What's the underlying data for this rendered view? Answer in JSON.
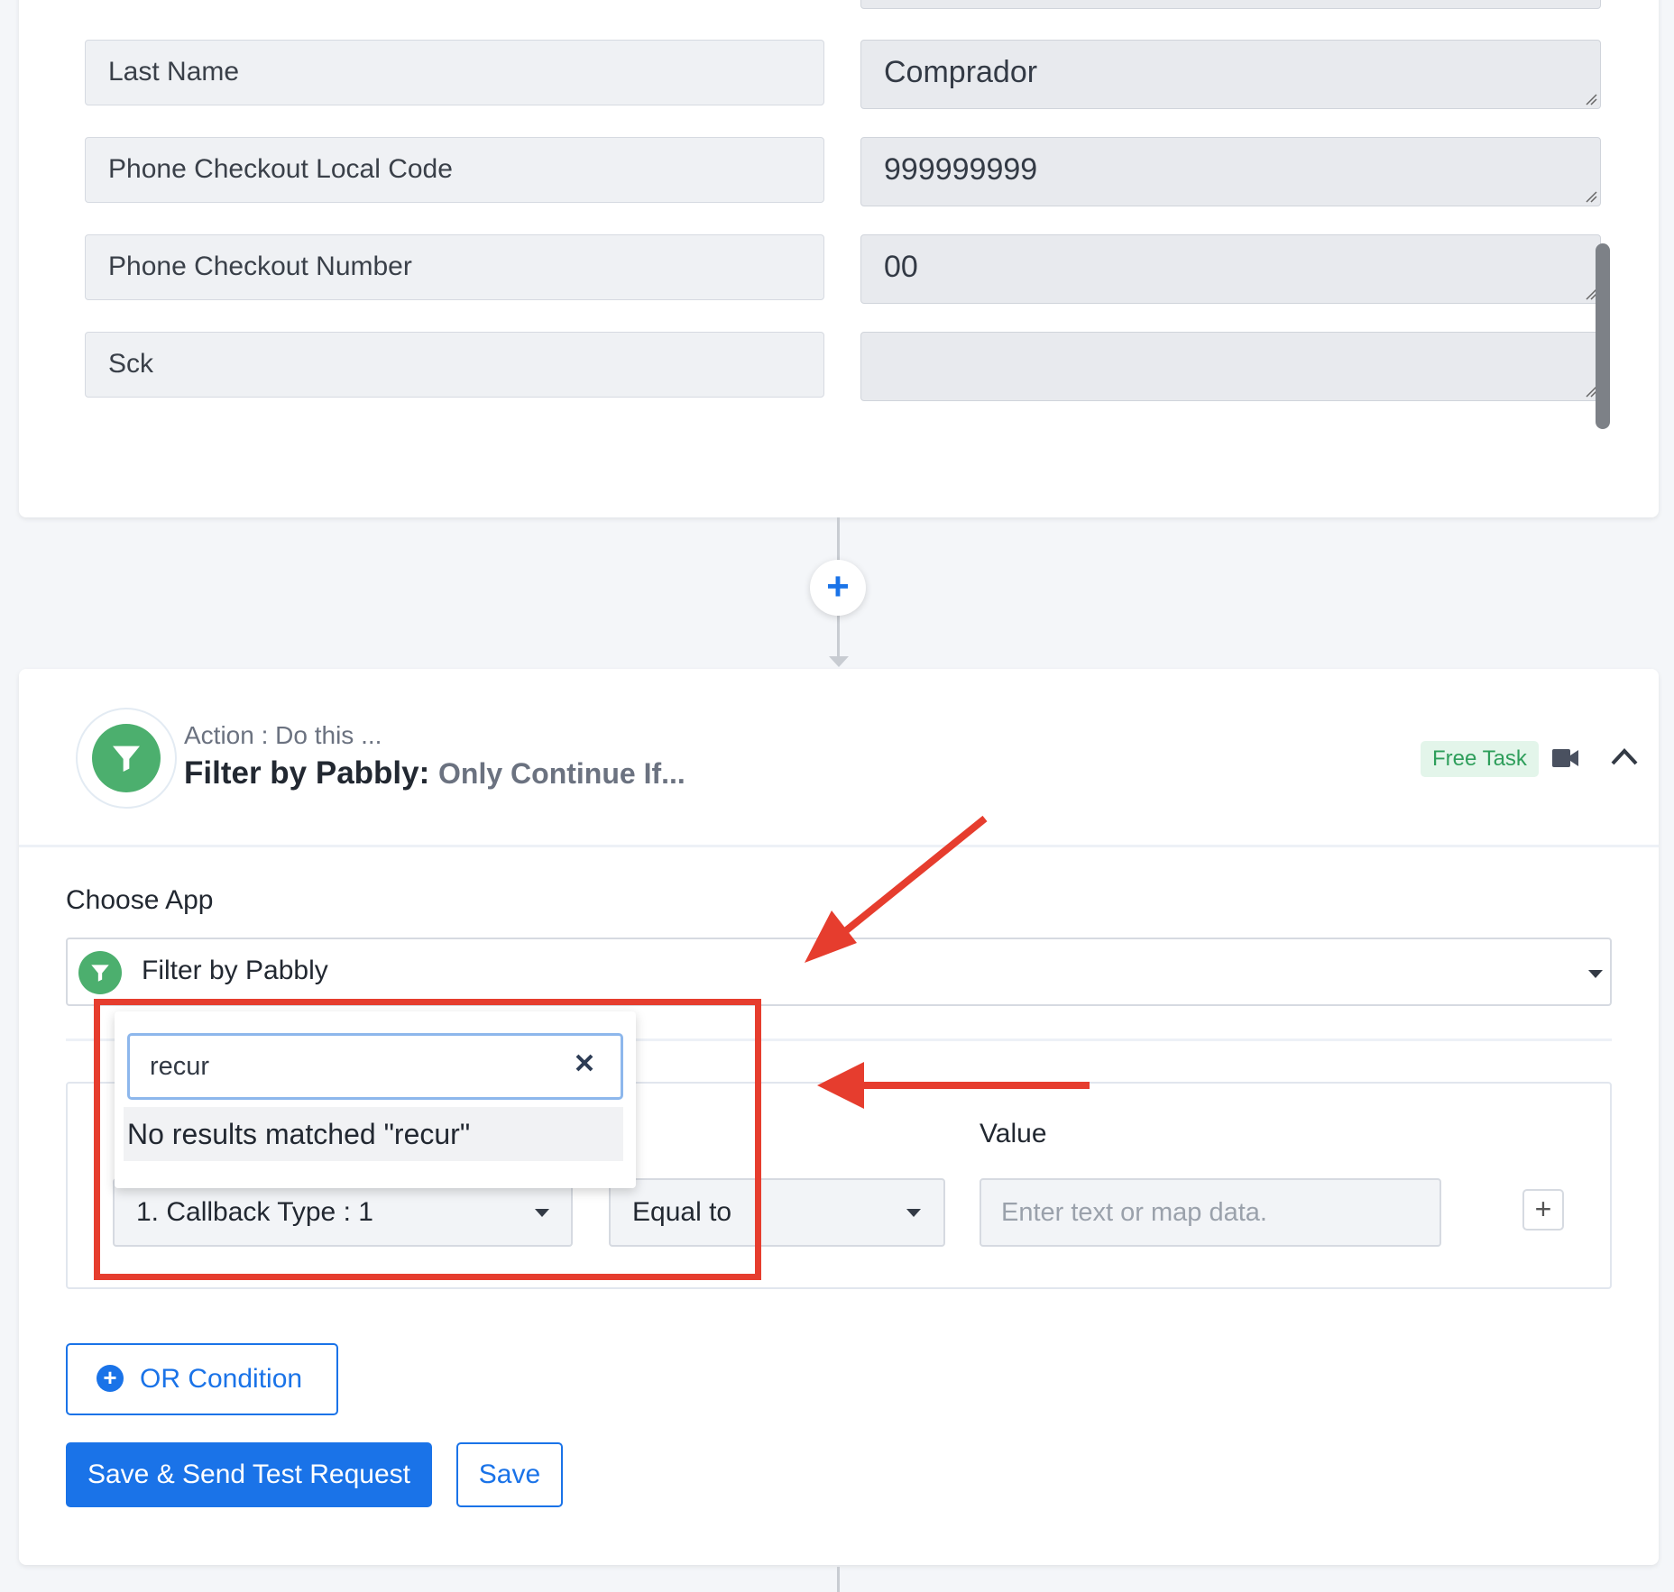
{
  "mapping_rows": [
    {
      "key": "Last Name",
      "value": "Comprador"
    },
    {
      "key": "Phone Checkout Local Code",
      "value": "999999999"
    },
    {
      "key": "Phone Checkout Number",
      "value": "00"
    },
    {
      "key": "Sck",
      "value": ""
    }
  ],
  "connector": {
    "add_symbol": "+"
  },
  "action": {
    "subtitle": "Action : Do this ...",
    "title_app": "Filter by Pabbly:",
    "title_event": "Only Continue If...",
    "badge": "Free Task",
    "choose_app_label": "Choose App",
    "selected_app": "Filter by Pabbly",
    "icons": {
      "app": "filter-icon",
      "video": "video-camera-icon",
      "collapse": "chevron-up-icon"
    },
    "brand_color": "#4caf6e"
  },
  "filter": {
    "value_label": "Value",
    "field_select": "1. Callback Type : 1",
    "operator_select": "Equal to",
    "value_placeholder": "Enter text or map data.",
    "add_symbol": "+",
    "dropdown": {
      "search_value": "recur",
      "no_results": "No results matched \"recur\""
    }
  },
  "buttons": {
    "or_condition": "OR Condition",
    "save_and_test": "Save & Send Test Request",
    "save": "Save"
  },
  "colors": {
    "accent": "#1a73e8",
    "annotation": "#e63d2e"
  }
}
